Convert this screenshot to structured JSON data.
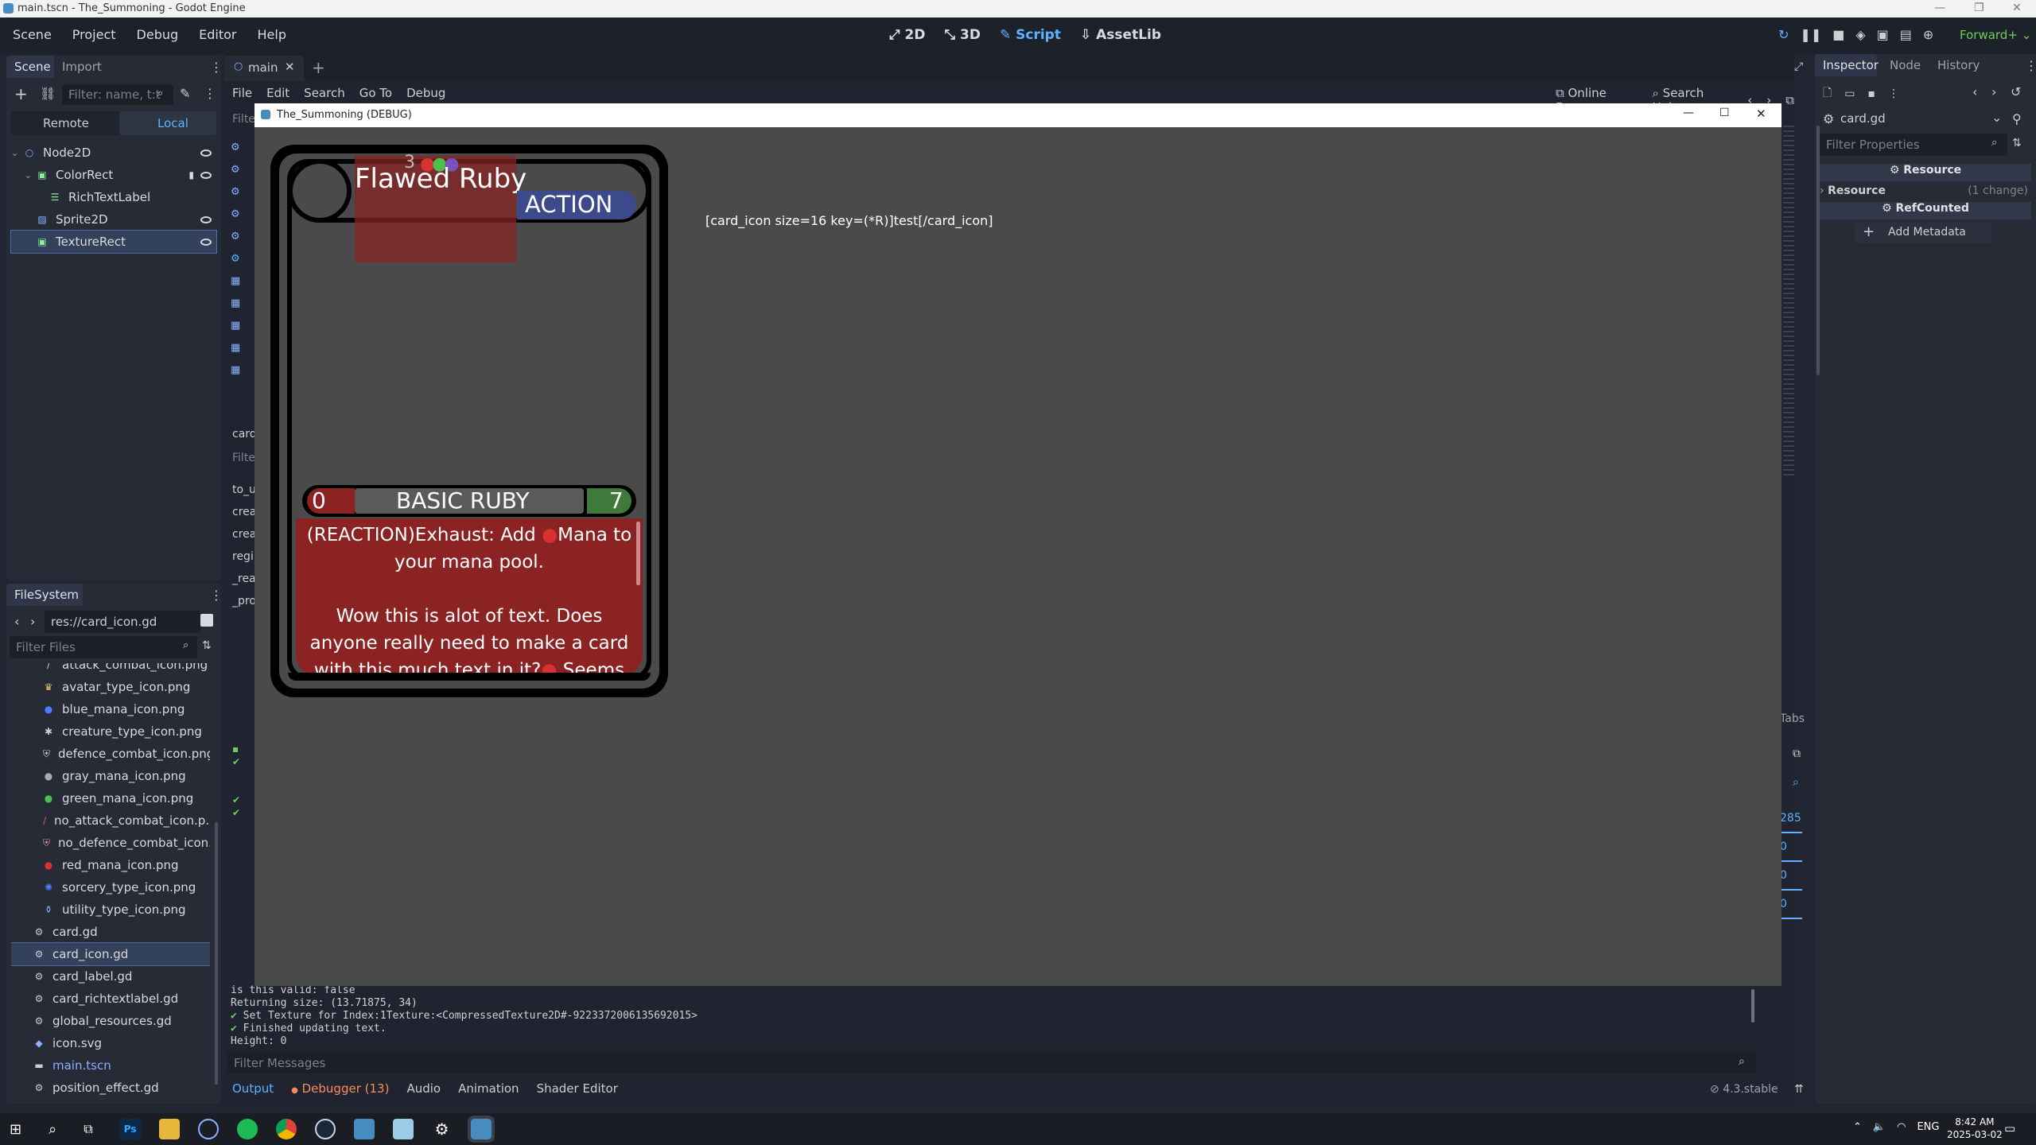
{
  "window": {
    "title": "main.tscn - The_Summoning - Godot Engine"
  },
  "menu": [
    "Scene",
    "Project",
    "Debug",
    "Editor",
    "Help"
  ],
  "workspaces": [
    "2D",
    "3D",
    "Script",
    "AssetLib"
  ],
  "renderer": "Forward+",
  "scene_dock": {
    "tabs": [
      "Scene",
      "Import"
    ],
    "filter_placeholder": "Filter: name, t:t",
    "modes": [
      "Remote",
      "Local"
    ],
    "nodes": [
      "Node2D",
      "ColorRect",
      "RichTextLabel",
      "Sprite2D",
      "TextureRect"
    ]
  },
  "filesystem": {
    "title": "FileSystem",
    "path": "res://card_icon.gd",
    "filter_placeholder": "Filter Files",
    "files": [
      "attack_combat_icon.png",
      "avatar_type_icon.png",
      "blue_mana_icon.png",
      "creature_type_icon.png",
      "defence_combat_icon.png",
      "gray_mana_icon.png",
      "green_mana_icon.png",
      "no_attack_combat_icon.p...",
      "no_defence_combat_icon...",
      "red_mana_icon.png",
      "sorcery_type_icon.png",
      "utility_type_icon.png",
      "card.gd",
      "card_icon.gd",
      "card_label.gd",
      "card_richtextlabel.gd",
      "global_resources.gd",
      "icon.svg",
      "main.tscn",
      "position_effect.gd"
    ]
  },
  "editor": {
    "tab": "main",
    "menu": [
      "File",
      "Edit",
      "Search",
      "Go To",
      "Debug"
    ],
    "online_docs": "Online Docs",
    "search_help": "Search Help",
    "side_filter": "Filte",
    "side_list": [
      "card"
    ],
    "side_filter2": "Filte",
    "methods": [
      "to_u",
      "crea",
      "crea",
      "regi",
      "_rea",
      "_pro"
    ],
    "tabs_label": "Tabs",
    "field_values": [
      "285",
      "0",
      "0",
      "0"
    ]
  },
  "console": {
    "lines": [
      "is this valid: false",
      "Returning size: (13.71875, 34)",
      "Set Texture for Index:1Texture:<CompressedTexture2D#-9223372006135692015>",
      "Finished updating text.",
      "Height: 0"
    ],
    "filter_placeholder": "Filter Messages",
    "bottom_tabs": [
      "Output",
      "Debugger (13)",
      "Audio",
      "Animation",
      "Shader Editor"
    ],
    "version": "4.3.stable"
  },
  "game_window": {
    "title": "The_Summoning (DEBUG)",
    "bbcode_text": "[card_icon size=16 key=(*R)]test[/card_icon]"
  },
  "card": {
    "name": "Flawed Ruby",
    "cost_number": "3",
    "type": "ACTION",
    "attack": "0",
    "subtype": "BASIC RUBY",
    "defence": "7",
    "text_line1": "(REACTION)Exhaust: Add",
    "text_line1b": "Mana to",
    "text_line2": "your mana pool.",
    "text_line3": "Wow this is alot of text. Does",
    "text_line4": "anyone really need to make a card",
    "text_line5": "with this much text in it?",
    "text_line5b": "Seems"
  },
  "inspector": {
    "tabs": [
      "Inspector",
      "Node",
      "History"
    ],
    "resource_name": "card.gd",
    "filter_placeholder": "Filter Properties",
    "section_resource": "Resource",
    "sub_resource": "Resource",
    "sub_resource_note": "(1 change)",
    "section_refcounted": "RefCounted",
    "add_metadata": "Add Metadata"
  },
  "taskbar": {
    "lang": "ENG",
    "time": "8:42 AM",
    "date": "2025-03-02"
  },
  "colors": {
    "accent": "#5fb2ff",
    "card_red": "#8b2323",
    "action_blue": "#3c4a8c",
    "defence_green": "#3f7a3a"
  }
}
